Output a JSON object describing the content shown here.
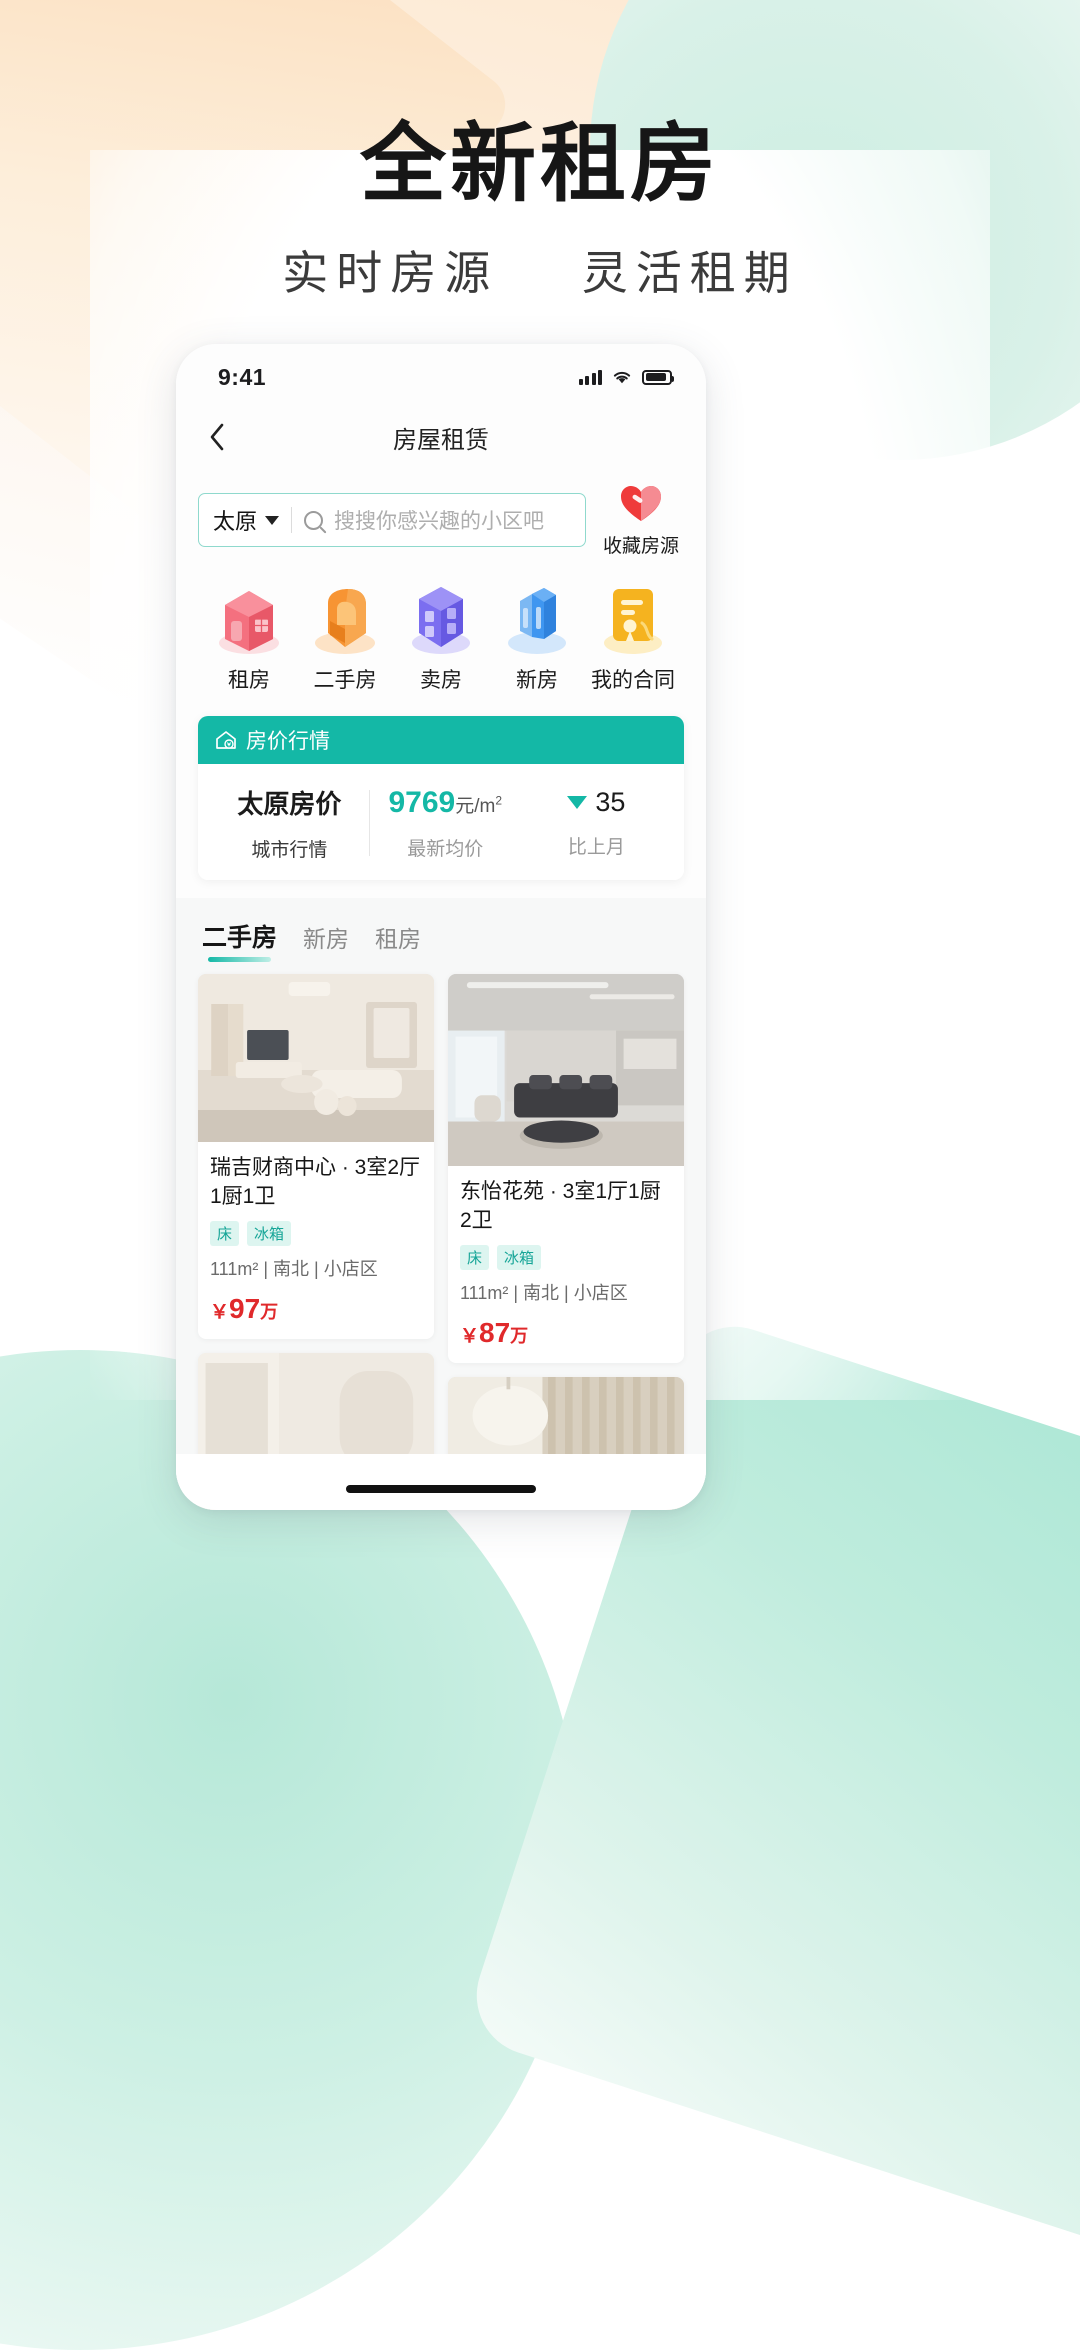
{
  "hero": {
    "title": "全新租房",
    "subtitle_left": "实时房源",
    "subtitle_right": "灵活租期"
  },
  "colors": {
    "accent_teal": "#14b8a6",
    "price_red": "#e0292b",
    "tag_bg": "#ddf5f0",
    "tag_text": "#16a597",
    "search_border": "#8fd9cd"
  },
  "statusbar": {
    "time": "9:41",
    "signal_icon": "signal-bars-icon",
    "wifi_icon": "wifi-icon",
    "battery_icon": "battery-icon"
  },
  "navbar": {
    "back_icon": "chevron-left-icon",
    "title": "房屋租赁"
  },
  "search": {
    "city": "太原",
    "city_caret_icon": "chevron-down-icon",
    "search_icon": "search-icon",
    "placeholder": "搜搜你感兴趣的小区吧",
    "value": "",
    "favorite": {
      "icon": "heart-icon",
      "label": "收藏房源"
    }
  },
  "categories": [
    {
      "label": "租房",
      "icon": "house-icon",
      "color": "#f2687a"
    },
    {
      "label": "二手房",
      "icon": "armchair-icon",
      "color": "#f79433"
    },
    {
      "label": "卖房",
      "icon": "building-icon",
      "color": "#7b6ef0"
    },
    {
      "label": "新房",
      "icon": "tower-icon",
      "color": "#3f96f0"
    },
    {
      "label": "我的合同",
      "icon": "contract-icon",
      "color": "#f5b31f"
    }
  ],
  "price_card": {
    "header_icon": "home-price-icon",
    "header_title": "房价行情",
    "city_price_label": "太原房价",
    "city_price_sub": "城市行情",
    "avg_value": "9769",
    "avg_unit": "元/m",
    "avg_unit_sup": "2",
    "avg_sub": "最新均价",
    "delta_icon": "triangle-down-icon",
    "delta_value": "35",
    "delta_sub": "比上月"
  },
  "tabs": [
    {
      "label": "二手房",
      "active": true
    },
    {
      "label": "新房",
      "active": false
    },
    {
      "label": "租房",
      "active": false
    }
  ],
  "listings": [
    {
      "title": "瑞吉财商中心 · 3室2厅1厨1卫",
      "tags": [
        "床",
        "冰箱"
      ],
      "meta": "111m² | 南北 | 小店区",
      "price_symbol": "￥",
      "price_value": "97",
      "price_unit": "万",
      "image_alt": "living-room-beige"
    },
    {
      "title": "东怡花苑 · 3室1厅1厨2卫",
      "tags": [
        "床",
        "冰箱"
      ],
      "meta": "111m² | 南北 | 小店区",
      "price_symbol": "￥",
      "price_value": "87",
      "price_unit": "万",
      "image_alt": "living-room-dark-sofa"
    },
    {
      "title": "",
      "tags": [],
      "meta": "",
      "price_symbol": "",
      "price_value": "",
      "price_unit": "",
      "image_alt": "bedroom-cream"
    },
    {
      "title": "",
      "tags": [],
      "meta": "",
      "price_symbol": "",
      "price_value": "",
      "price_unit": "",
      "image_alt": "window-wood-slats"
    }
  ]
}
